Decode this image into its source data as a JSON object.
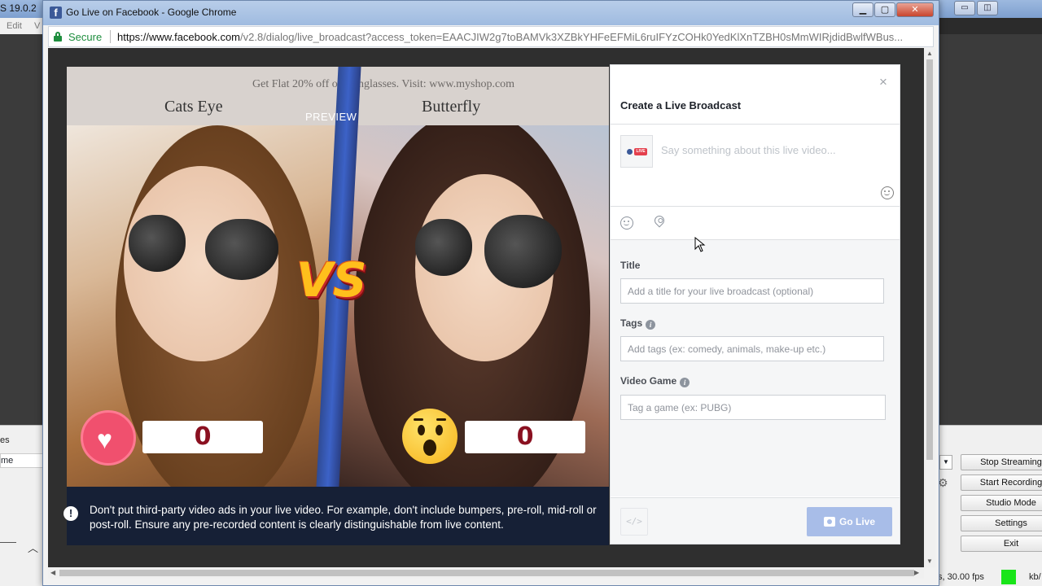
{
  "obs": {
    "title_fragment": "S 19.0.2",
    "menu": [
      "Edit",
      "V"
    ],
    "dock_labels": [
      "es",
      "me"
    ],
    "buttons": [
      "Stop Streaming",
      "Start Recording",
      "Studio Mode",
      "Settings",
      "Exit"
    ],
    "status_fps": "s, 30.00 fps",
    "status_kb": "kb/",
    "fps_indicator_color": "#19e519"
  },
  "chrome": {
    "window_title": "Go Live on Facebook - Google Chrome",
    "favicon": "f",
    "secure_label": "Secure",
    "url_domain": "https://www.facebook.com",
    "url_path": "/v2.8/dialog/live_broadcast?access_token=EAACJIW2g7toBAMVk3XZBkYHFeEFMiL6ruIFYzCOHk0YedKlXnTZBH0sMmWIRjdidBwlfWBus..."
  },
  "video": {
    "promo_text": "Get Flat 20% off on Sunglasses. Visit: www.myshop.com",
    "left_label": "Cats Eye",
    "right_label": "Butterfly",
    "preview_label": "PREVIEW",
    "vs_text": "VS",
    "left_count": "0",
    "right_count": "0",
    "heart_glyph": "♥"
  },
  "notice": {
    "icon": "!",
    "text": "Don't put third-party video ads in your live video. For example, don't include bumpers, pre-roll, mid-roll or post-roll. Ensure any pre-recorded content is clearly distinguishable from live content."
  },
  "dialog": {
    "close_glyph": "×",
    "title": "Create a Live Broadcast",
    "avatar_badge": "LIVE",
    "compose_placeholder": "Say something about this live video...",
    "title_label": "Title",
    "title_placeholder": "Add a title for your live broadcast (optional)",
    "tags_label": "Tags",
    "tags_placeholder": "Add tags (ex: comedy, animals, make-up etc.)",
    "game_label": "Video Game",
    "game_placeholder": "Tag a game (ex: PUBG)",
    "help_glyph": "i",
    "embed_glyph": "</>",
    "go_live_label": "Go Live"
  }
}
